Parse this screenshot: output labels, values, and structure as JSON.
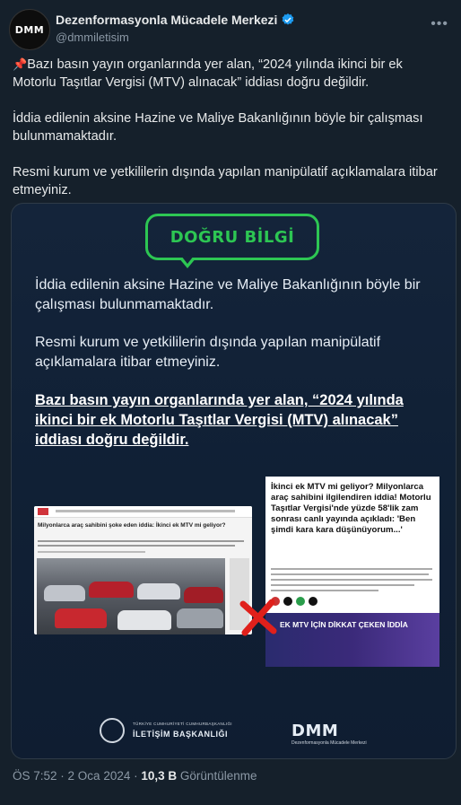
{
  "author": {
    "display_name": "Dezenformasyonla Mücadele Merkezi",
    "handle": "@dmmiletisim",
    "avatar_text": "DMM"
  },
  "tweet": {
    "line1_rest": "Bazı basın yayın organlarında yer alan, “2024 yılında ikinci bir ek Motorlu Taşıtlar Vergisi (MTV) alınacak” iddiası doğru değildir.",
    "line2": "İddia edilenin aksine Hazine ve Maliye Bakanlığının böyle bir çalışması bulunmamaktadır.",
    "line3": "Resmi kurum ve yetkililerin dışında yapılan manipülatif açıklamalara itibar etmeyiniz."
  },
  "card": {
    "badge": "DOĞRU BİLGİ",
    "para1": "İddia edilenin aksine Hazine ve Maliye Bakanlığının böyle bir çalışması bulunmamaktadır.",
    "para2": "Resmi kurum ve yetkililerin dışında yapılan manipülatif açıklamalara itibar etmeyiniz.",
    "bold_claim": "Bazı basın yayın organlarında yer alan, “2024 yılında ikinci bir ek Motorlu Taşıtlar Vergisi (MTV) alınacak” iddiası doğru değildir.",
    "news1_title": "Milyonlarca araç sahibini şoke eden iddia: İkinci ek MTV mi geliyor?",
    "news2_title": "İkinci ek MTV mi geliyor? Milyonlarca araç sahibini ilgilendiren iddia! Motorlu Taşıtlar Vergisi'nde yüzde 58'lik zam sonrası canlı yayında açıkladı: 'Ben şimdi kara kara düşünüyorum...'",
    "news2_banner": "EK MTV İÇİN DİKKAT ÇEKEN İDDİA",
    "footer_org_sub": "TÜRKİYE CUMHURİYETİ CUMHURBAŞKANLIĞI",
    "footer_org": "İLETİŞİM BAŞKANLIĞI",
    "footer_dmm": "DMM",
    "footer_dmm_sub": "Dezenformasyonla Mücadele Merkezi"
  },
  "meta": {
    "time": "ÖS 7:52",
    "date": "2 Oca 2024",
    "views_count": "10,3 B",
    "views_label": "Görüntülenme"
  },
  "icons": {
    "verified": "verified-badge-icon",
    "pin": "pushpin-icon",
    "more": "more-icon",
    "cross": "red-cross-icon"
  },
  "colors": {
    "background": "#15202b",
    "accent_green": "#2dc653",
    "verified_blue": "#1d9bf0",
    "cross_red": "#e0201b"
  }
}
